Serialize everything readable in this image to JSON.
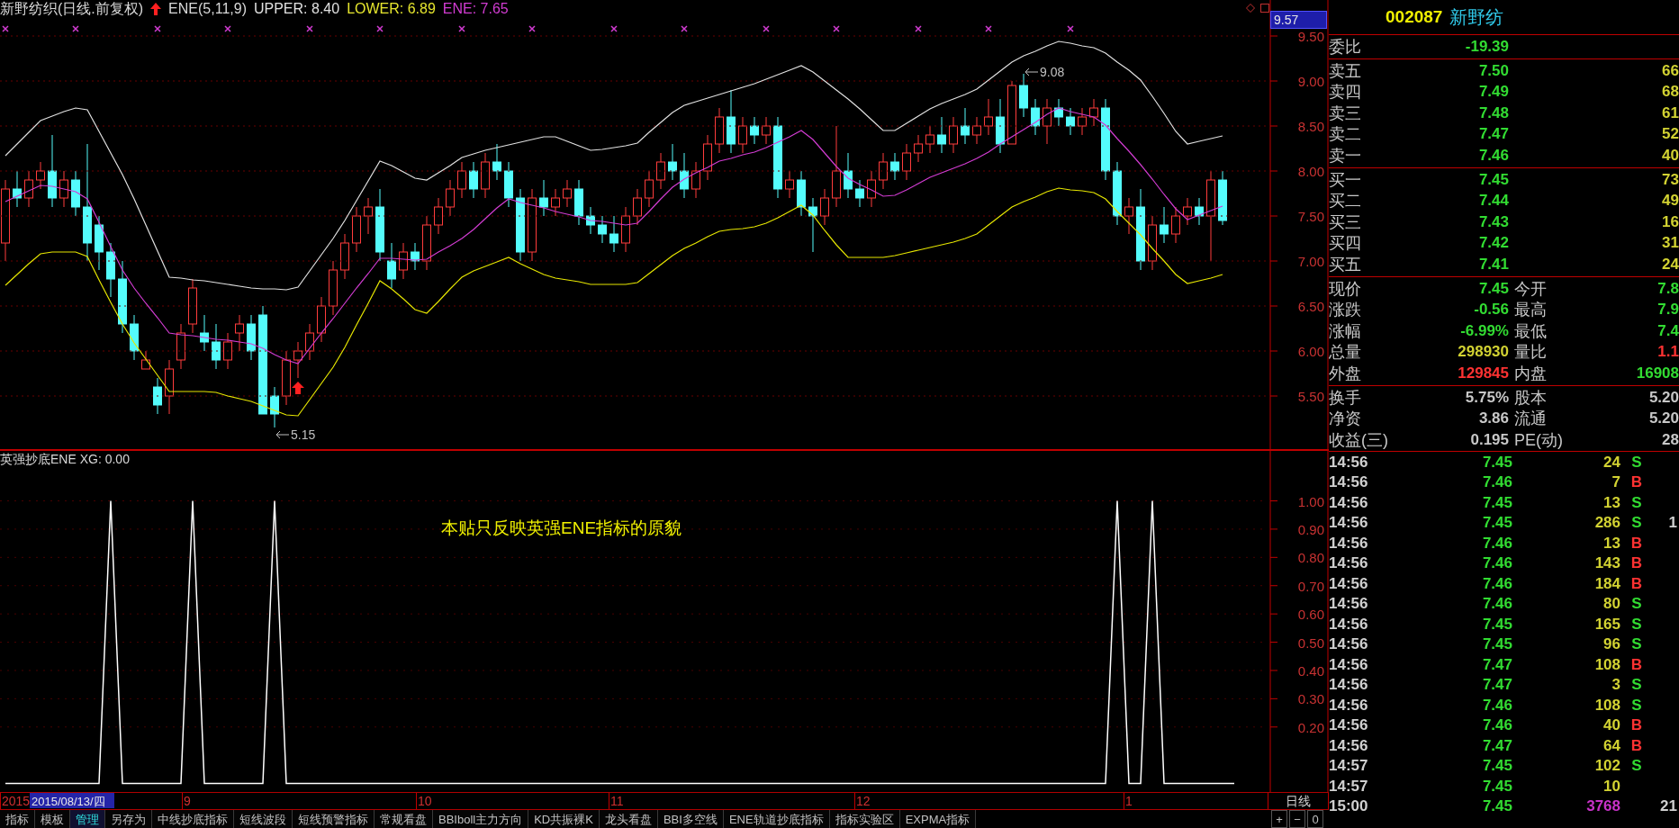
{
  "header": {
    "title": "新野纺织(日线.前复权)",
    "indicator": "ENE(5,11,9)",
    "values": [
      {
        "text": "UPPER: 8.40",
        "color": "#e0e0e0"
      },
      {
        "text": "LOWER: 6.89",
        "color": "#e6e62e"
      },
      {
        "text": "ENE: 7.65",
        "color": "#d23cd2"
      }
    ]
  },
  "price_panel": {
    "cursor_price": "9.57",
    "chart_data": {
      "type": "candlestick",
      "ylim": [
        4.9,
        9.9
      ],
      "ohlc": [
        [
          7.2,
          7.9,
          7.0,
          7.8
        ],
        [
          7.8,
          8.0,
          7.6,
          7.7
        ],
        [
          7.7,
          8.0,
          7.6,
          7.9
        ],
        [
          7.9,
          8.1,
          7.8,
          8.0
        ],
        [
          8.0,
          8.4,
          7.6,
          7.7
        ],
        [
          7.7,
          8.0,
          7.6,
          7.9
        ],
        [
          7.9,
          8.0,
          7.5,
          7.6
        ],
        [
          7.6,
          8.3,
          7.0,
          7.2
        ],
        [
          7.4,
          7.5,
          6.9,
          7.1
        ],
        [
          7.1,
          7.2,
          6.6,
          6.8
        ],
        [
          6.8,
          7.0,
          6.2,
          6.3
        ],
        [
          6.3,
          6.4,
          5.9,
          6.0
        ],
        [
          5.8,
          6.0,
          5.8,
          5.9
        ],
        [
          5.6,
          5.7,
          5.3,
          5.4
        ],
        [
          5.5,
          5.9,
          5.3,
          5.8
        ],
        [
          5.9,
          6.3,
          5.8,
          6.2
        ],
        [
          6.3,
          6.8,
          6.2,
          6.7
        ],
        [
          6.2,
          6.4,
          6.0,
          6.1
        ],
        [
          6.1,
          6.3,
          5.8,
          5.9
        ],
        [
          5.9,
          6.2,
          5.8,
          6.1
        ],
        [
          6.2,
          6.4,
          6.0,
          6.3
        ],
        [
          6.3,
          6.4,
          5.9,
          6.0
        ],
        [
          6.4,
          6.5,
          5.3,
          5.3
        ],
        [
          5.5,
          5.6,
          5.15,
          5.3
        ],
        [
          5.5,
          6.0,
          5.4,
          5.9
        ],
        [
          5.9,
          6.1,
          5.7,
          6.0
        ],
        [
          6.0,
          6.3,
          5.9,
          6.2
        ],
        [
          6.2,
          6.6,
          6.1,
          6.5
        ],
        [
          6.5,
          7.0,
          6.4,
          6.9
        ],
        [
          6.9,
          7.3,
          6.8,
          7.2
        ],
        [
          7.2,
          7.6,
          7.1,
          7.5
        ],
        [
          7.5,
          7.7,
          7.3,
          7.6
        ],
        [
          7.6,
          7.8,
          7.0,
          7.1
        ],
        [
          7.0,
          7.2,
          6.7,
          6.8
        ],
        [
          6.9,
          7.2,
          6.8,
          7.1
        ],
        [
          7.1,
          7.2,
          6.9,
          7.0
        ],
        [
          7.0,
          7.5,
          6.9,
          7.4
        ],
        [
          7.4,
          7.7,
          7.3,
          7.6
        ],
        [
          7.6,
          7.9,
          7.5,
          7.8
        ],
        [
          7.8,
          8.1,
          7.7,
          8.0
        ],
        [
          8.0,
          8.1,
          7.7,
          7.8
        ],
        [
          7.8,
          8.2,
          7.7,
          8.1
        ],
        [
          8.1,
          8.3,
          7.9,
          8.0
        ],
        [
          8.0,
          8.1,
          7.6,
          7.7
        ],
        [
          7.7,
          7.8,
          7.0,
          7.1
        ],
        [
          7.1,
          7.8,
          7.0,
          7.7
        ],
        [
          7.7,
          7.9,
          7.5,
          7.6
        ],
        [
          7.6,
          7.8,
          7.5,
          7.7
        ],
        [
          7.7,
          7.9,
          7.6,
          7.8
        ],
        [
          7.8,
          7.9,
          7.4,
          7.5
        ],
        [
          7.5,
          7.6,
          7.3,
          7.4
        ],
        [
          7.4,
          7.5,
          7.2,
          7.3
        ],
        [
          7.3,
          7.5,
          7.1,
          7.2
        ],
        [
          7.2,
          7.6,
          7.1,
          7.5
        ],
        [
          7.5,
          7.8,
          7.4,
          7.7
        ],
        [
          7.7,
          8.0,
          7.6,
          7.9
        ],
        [
          7.9,
          8.2,
          7.8,
          8.1
        ],
        [
          8.1,
          8.3,
          7.9,
          8.0
        ],
        [
          8.0,
          8.2,
          7.7,
          7.8
        ],
        [
          7.8,
          8.1,
          7.7,
          8.0
        ],
        [
          8.0,
          8.4,
          7.9,
          8.3
        ],
        [
          8.3,
          8.7,
          8.2,
          8.6
        ],
        [
          8.6,
          8.9,
          8.2,
          8.3
        ],
        [
          8.3,
          8.6,
          8.2,
          8.5
        ],
        [
          8.5,
          8.6,
          8.3,
          8.4
        ],
        [
          8.4,
          8.6,
          8.3,
          8.5
        ],
        [
          8.5,
          8.6,
          7.7,
          7.8
        ],
        [
          7.8,
          8.0,
          7.7,
          7.9
        ],
        [
          7.9,
          8.0,
          7.5,
          7.6
        ],
        [
          7.6,
          7.7,
          7.1,
          7.5
        ],
        [
          7.5,
          7.8,
          7.4,
          7.7
        ],
        [
          7.7,
          8.5,
          7.6,
          8.0
        ],
        [
          8.0,
          8.2,
          7.7,
          7.8
        ],
        [
          7.8,
          7.9,
          7.6,
          7.7
        ],
        [
          7.7,
          8.0,
          7.6,
          7.9
        ],
        [
          7.9,
          8.2,
          7.8,
          8.1
        ],
        [
          8.1,
          8.2,
          7.9,
          8.0
        ],
        [
          8.0,
          8.3,
          7.9,
          8.2
        ],
        [
          8.2,
          8.4,
          8.1,
          8.3
        ],
        [
          8.3,
          8.5,
          8.2,
          8.4
        ],
        [
          8.4,
          8.6,
          8.2,
          8.3
        ],
        [
          8.3,
          8.6,
          8.2,
          8.5
        ],
        [
          8.5,
          8.7,
          8.3,
          8.4
        ],
        [
          8.4,
          8.6,
          8.3,
          8.5
        ],
        [
          8.5,
          8.8,
          8.4,
          8.6
        ],
        [
          8.6,
          8.8,
          8.2,
          8.3
        ],
        [
          8.3,
          9.0,
          8.3,
          8.95
        ],
        [
          8.95,
          9.08,
          8.6,
          8.7
        ],
        [
          8.7,
          8.8,
          8.4,
          8.5
        ],
        [
          8.5,
          8.8,
          8.3,
          8.7
        ],
        [
          8.7,
          8.8,
          8.5,
          8.6
        ],
        [
          8.6,
          8.7,
          8.4,
          8.5
        ],
        [
          8.5,
          8.7,
          8.4,
          8.6
        ],
        [
          8.6,
          8.8,
          8.5,
          8.7
        ],
        [
          8.7,
          8.8,
          7.9,
          8.0
        ],
        [
          8.0,
          8.1,
          7.4,
          7.5
        ],
        [
          7.5,
          7.7,
          7.3,
          7.6
        ],
        [
          7.6,
          7.8,
          6.9,
          7.0
        ],
        [
          7.0,
          7.5,
          6.9,
          7.4
        ],
        [
          7.4,
          7.6,
          7.2,
          7.3
        ],
        [
          7.3,
          7.6,
          7.2,
          7.5
        ],
        [
          7.5,
          7.7,
          7.4,
          7.6
        ],
        [
          7.6,
          7.7,
          7.4,
          7.5
        ],
        [
          7.5,
          8.0,
          7.0,
          7.9
        ],
        [
          7.9,
          8.0,
          7.4,
          7.45
        ]
      ],
      "annotations": [
        {
          "text": "9.08"
        },
        {
          "text": "5.15"
        }
      ]
    },
    "bands": {
      "chart_data": {
        "type": "line",
        "ylim": [
          4.9,
          9.9
        ],
        "grid": true,
        "yticks": [
          {
            "value": 9.5,
            "label": "9.50"
          },
          {
            "value": 9.0,
            "label": "9.00"
          },
          {
            "value": 8.5,
            "label": "8.50"
          },
          {
            "value": 8.0,
            "label": "8.00"
          },
          {
            "value": 7.5,
            "label": "7.50"
          },
          {
            "value": 7.0,
            "label": "7.00"
          },
          {
            "value": 6.5,
            "label": "6.50"
          },
          {
            "value": 6.0,
            "label": "6.00"
          },
          {
            "value": 5.5,
            "label": "5.50"
          }
        ],
        "series": [
          {
            "color": "#e0e0e0",
            "values": [
              8.17,
              8.3,
              8.43,
              8.56,
              8.61,
              8.66,
              8.7,
              8.68,
              8.44,
              8.2,
              7.96,
              7.69,
              7.4,
              7.11,
              6.82,
              6.81,
              6.79,
              6.78,
              6.76,
              6.74,
              6.72,
              6.7,
              6.69,
              6.69,
              6.68,
              6.71,
              6.89,
              7.07,
              7.25,
              7.45,
              7.67,
              7.89,
              8.11,
              8.06,
              7.99,
              7.92,
              7.9,
              7.98,
              8.06,
              8.15,
              8.19,
              8.23,
              8.26,
              8.29,
              8.32,
              8.35,
              8.38,
              8.38,
              8.33,
              8.28,
              8.23,
              8.24,
              8.26,
              8.28,
              8.31,
              8.43,
              8.54,
              8.65,
              8.73,
              8.77,
              8.81,
              8.85,
              8.89,
              8.93,
              8.97,
              9.02,
              9.07,
              9.12,
              9.17,
              9.1,
              9.0,
              8.9,
              8.8,
              8.69,
              8.57,
              8.45,
              8.45,
              8.53,
              8.61,
              8.69,
              8.75,
              8.8,
              8.85,
              8.91,
              9.01,
              9.11,
              9.21,
              9.28,
              9.33,
              9.39,
              9.44,
              9.42,
              9.39,
              9.37,
              9.31,
              9.21,
              9.12,
              9.01,
              8.83,
              8.64,
              8.44,
              8.3,
              8.33,
              8.36,
              8.39
            ]
          },
          {
            "color": "#d23cd2",
            "values": [
              7.66,
              7.72,
              7.78,
              7.84,
              7.83,
              7.8,
              7.77,
              7.69,
              7.43,
              7.16,
              6.9,
              6.7,
              6.53,
              6.37,
              6.2,
              6.18,
              6.17,
              6.15,
              6.13,
              6.12,
              6.1,
              6.08,
              6.03,
              5.96,
              5.9,
              5.86,
              6.03,
              6.2,
              6.36,
              6.53,
              6.7,
              6.86,
              7.03,
              7.03,
              7.02,
              7.01,
              7.02,
              7.1,
              7.17,
              7.25,
              7.35,
              7.47,
              7.59,
              7.69,
              7.65,
              7.62,
              7.59,
              7.55,
              7.52,
              7.49,
              7.45,
              7.44,
              7.42,
              7.4,
              7.42,
              7.55,
              7.69,
              7.82,
              7.91,
              7.98,
              8.04,
              8.11,
              8.14,
              8.18,
              8.21,
              8.26,
              8.32,
              8.38,
              8.45,
              8.35,
              8.2,
              8.05,
              7.92,
              7.85,
              7.79,
              7.72,
              7.73,
              7.79,
              7.86,
              7.93,
              7.98,
              8.03,
              8.08,
              8.14,
              8.21,
              8.3,
              8.38,
              8.46,
              8.54,
              8.63,
              8.7,
              8.66,
              8.63,
              8.6,
              8.51,
              8.36,
              8.22,
              8.07,
              7.91,
              7.74,
              7.58,
              7.46,
              7.51,
              7.56,
              7.61
            ]
          },
          {
            "color": "#e6e600",
            "values": [
              6.73,
              6.85,
              6.97,
              7.08,
              7.1,
              7.1,
              7.1,
              7.05,
              6.79,
              6.54,
              6.3,
              6.09,
              5.91,
              5.73,
              5.55,
              5.55,
              5.55,
              5.55,
              5.54,
              5.5,
              5.47,
              5.44,
              5.39,
              5.34,
              5.29,
              5.28,
              5.46,
              5.64,
              5.82,
              6.04,
              6.29,
              6.53,
              6.78,
              6.69,
              6.58,
              6.46,
              6.42,
              6.55,
              6.69,
              6.82,
              6.89,
              6.94,
              6.99,
              7.04,
              6.97,
              6.91,
              6.85,
              6.81,
              6.79,
              6.77,
              6.74,
              6.74,
              6.74,
              6.74,
              6.76,
              6.86,
              6.96,
              7.06,
              7.14,
              7.2,
              7.27,
              7.33,
              7.35,
              7.36,
              7.38,
              7.42,
              7.48,
              7.55,
              7.62,
              7.51,
              7.34,
              7.18,
              7.04,
              7.04,
              7.04,
              7.04,
              7.06,
              7.09,
              7.12,
              7.15,
              7.18,
              7.21,
              7.25,
              7.3,
              7.4,
              7.5,
              7.6,
              7.66,
              7.71,
              7.77,
              7.81,
              7.79,
              7.78,
              7.76,
              7.69,
              7.55,
              7.42,
              7.29,
              7.14,
              7.0,
              6.85,
              6.75,
              6.78,
              6.81,
              6.85
            ]
          }
        ]
      }
    }
  },
  "indicator_panel": {
    "title": "英强抄底ENE XG: 0.00",
    "note": "本贴只反映英强ENE指标的原貌",
    "cursor_date": "2015/08/13/四",
    "chart_data": {
      "type": "line",
      "ylim": [
        -0.03,
        1.18
      ],
      "grid": true,
      "yticks": [
        {
          "value": 1.0,
          "label": "1.00"
        },
        {
          "value": 0.9,
          "label": "0.90"
        },
        {
          "value": 0.8,
          "label": "0.80"
        },
        {
          "value": 0.7,
          "label": "0.70"
        },
        {
          "value": 0.6,
          "label": "0.60"
        },
        {
          "value": 0.5,
          "label": "0.50"
        },
        {
          "value": 0.4,
          "label": "0.40"
        },
        {
          "value": 0.3,
          "label": "0.30"
        },
        {
          "value": 0.2,
          "label": "0.20"
        }
      ],
      "series": [
        {
          "color": "#ffffff",
          "values": [
            0,
            0,
            0,
            0,
            0,
            0,
            0,
            0,
            0,
            1,
            0,
            0,
            0,
            0,
            0,
            0,
            1,
            0,
            0,
            0,
            0,
            0,
            0,
            1,
            0,
            0,
            0,
            0,
            0,
            0,
            0,
            0,
            0,
            0,
            0,
            0,
            0,
            0,
            0,
            0,
            0,
            0,
            0,
            0,
            0,
            0,
            0,
            0,
            0,
            0,
            0,
            0,
            0,
            0,
            0,
            0,
            0,
            0,
            0,
            0,
            0,
            0,
            0,
            0,
            0,
            0,
            0,
            0,
            0,
            0,
            0,
            0,
            0,
            0,
            0,
            0,
            0,
            0,
            0,
            0,
            0,
            0,
            0,
            0,
            0,
            0,
            0,
            0,
            0,
            0,
            0,
            0,
            0,
            0,
            0,
            1,
            0,
            0,
            1,
            0,
            0,
            0,
            0,
            0,
            0,
            0
          ]
        }
      ]
    }
  },
  "date_axis": {
    "labels": [
      "2015",
      "9",
      "10",
      "11",
      "12",
      "1"
    ]
  },
  "period": "日线",
  "zoom_buttons": [
    "+",
    "−",
    "0"
  ],
  "tabs": [
    {
      "label": "指标",
      "selected": false
    },
    {
      "label": "模板",
      "selected": false
    },
    {
      "label": "管理",
      "selected": true
    },
    {
      "label": "另存为",
      "selected": false
    },
    {
      "label": "中线抄底指标",
      "selected": false
    },
    {
      "label": "短线波段",
      "selected": false
    },
    {
      "label": "短线预警指标",
      "selected": false
    },
    {
      "label": "常规看盘",
      "selected": false
    },
    {
      "label": "BBIboll主力方向",
      "selected": false
    },
    {
      "label": "KD共振裸K",
      "selected": false
    },
    {
      "label": "龙头看盘",
      "selected": false
    },
    {
      "label": "BBI多空线",
      "selected": false
    },
    {
      "label": "ENE轨道抄底指标",
      "selected": false
    },
    {
      "label": "指标实验区",
      "selected": false
    },
    {
      "label": "EXPMA指标",
      "selected": false
    }
  ],
  "quote": {
    "code": "002087",
    "name": "新野纺",
    "ratio": {
      "label": "委比",
      "value": "-19.39"
    },
    "asks": [
      {
        "label": "卖五",
        "price": "7.50",
        "volume": "66"
      },
      {
        "label": "卖四",
        "price": "7.49",
        "volume": "68"
      },
      {
        "label": "卖三",
        "price": "7.48",
        "volume": "61"
      },
      {
        "label": "卖二",
        "price": "7.47",
        "volume": "52"
      },
      {
        "label": "卖一",
        "price": "7.46",
        "volume": "40"
      }
    ],
    "bids": [
      {
        "label": "买一",
        "price": "7.45",
        "volume": "73"
      },
      {
        "label": "买二",
        "price": "7.44",
        "volume": "49"
      },
      {
        "label": "买三",
        "price": "7.43",
        "volume": "16"
      },
      {
        "label": "买四",
        "price": "7.42",
        "volume": "31"
      },
      {
        "label": "买五",
        "price": "7.41",
        "volume": "24"
      }
    ],
    "stats": [
      {
        "cells": [
          {
            "label": "现价",
            "value": "7.45",
            "color": "#32dc32"
          },
          {
            "label": "今开",
            "value": "7.8",
            "color": "#32dc32"
          }
        ]
      },
      {
        "cells": [
          {
            "label": "涨跌",
            "value": "-0.56",
            "color": "#32dc32"
          },
          {
            "label": "最高",
            "value": "7.9",
            "color": "#32dc32"
          }
        ]
      },
      {
        "cells": [
          {
            "label": "涨幅",
            "value": "-6.99%",
            "color": "#32dc32"
          },
          {
            "label": "最低",
            "value": "7.4",
            "color": "#32dc32"
          }
        ]
      },
      {
        "cells": [
          {
            "label": "总量",
            "value": "298930",
            "color": "#d2d232"
          },
          {
            "label": "量比",
            "value": "1.1",
            "color": "#ff3232"
          }
        ]
      },
      {
        "cells": [
          {
            "label": "外盘",
            "value": "129845",
            "color": "#ff3232"
          },
          {
            "label": "内盘",
            "value": "16908",
            "color": "#32dc32"
          }
        ]
      }
    ],
    "finance": [
      {
        "cells": [
          {
            "label": "换手",
            "value": "5.75%",
            "color": "#c8c8c8"
          },
          {
            "label": "股本",
            "value": "5.20",
            "color": "#c8c8c8"
          }
        ]
      },
      {
        "cells": [
          {
            "label": "净资",
            "value": "3.86",
            "color": "#c8c8c8"
          },
          {
            "label": "流通",
            "value": "5.20",
            "color": "#c8c8c8"
          }
        ]
      },
      {
        "cells": [
          {
            "label": "收益(三)",
            "value": "0.195",
            "color": "#c8c8c8"
          },
          {
            "label": "PE(动)",
            "value": "28",
            "color": "#c8c8c8"
          }
        ]
      }
    ],
    "ticks": [
      {
        "kind": "trade",
        "time": "14:56",
        "price": "7.45",
        "volume": "24",
        "side": "S",
        "color": "#32dc32"
      },
      {
        "kind": "trade",
        "time": "14:56",
        "price": "7.46",
        "volume": "7",
        "side": "B",
        "color": "#ff3232"
      },
      {
        "kind": "trade",
        "time": "14:56",
        "price": "7.45",
        "volume": "13",
        "side": "S",
        "color": "#32dc32"
      },
      {
        "kind": "trade",
        "time": "14:56",
        "price": "7.45",
        "volume": "286",
        "side": "S",
        "color": "#32dc32",
        "extra": "1"
      },
      {
        "kind": "trade",
        "time": "14:56",
        "price": "7.46",
        "volume": "13",
        "side": "B",
        "color": "#ff3232"
      },
      {
        "kind": "trade",
        "time": "14:56",
        "price": "7.46",
        "volume": "143",
        "side": "B",
        "color": "#ff3232"
      },
      {
        "kind": "trade",
        "time": "14:56",
        "price": "7.46",
        "volume": "184",
        "side": "B",
        "color": "#ff3232"
      },
      {
        "kind": "trade",
        "time": "14:56",
        "price": "7.46",
        "volume": "80",
        "side": "S",
        "color": "#32dc32"
      },
      {
        "kind": "trade",
        "time": "14:56",
        "price": "7.45",
        "volume": "165",
        "side": "S",
        "color": "#32dc32"
      },
      {
        "kind": "trade",
        "time": "14:56",
        "price": "7.45",
        "volume": "96",
        "side": "S",
        "color": "#32dc32"
      },
      {
        "kind": "trade",
        "time": "14:56",
        "price": "7.47",
        "volume": "108",
        "side": "B",
        "color": "#ff3232"
      },
      {
        "kind": "trade",
        "time": "14:56",
        "price": "7.47",
        "volume": "3",
        "side": "S",
        "color": "#32dc32"
      },
      {
        "kind": "trade",
        "time": "14:56",
        "price": "7.46",
        "volume": "108",
        "side": "S",
        "color": "#32dc32"
      },
      {
        "kind": "trade",
        "time": "14:56",
        "price": "7.46",
        "volume": "40",
        "side": "B",
        "color": "#ff3232"
      },
      {
        "kind": "trade",
        "time": "14:56",
        "price": "7.47",
        "volume": "64",
        "side": "B",
        "color": "#ff3232"
      },
      {
        "kind": "trade",
        "time": "14:57",
        "price": "7.45",
        "volume": "102",
        "side": "S",
        "color": "#32dc32"
      },
      {
        "kind": "trade",
        "time": "14:57",
        "price": "7.45",
        "volume": "10"
      },
      {
        "kind": "summary",
        "time": "15:00",
        "price": "7.45",
        "volume": "3768",
        "extra": "21"
      }
    ]
  }
}
